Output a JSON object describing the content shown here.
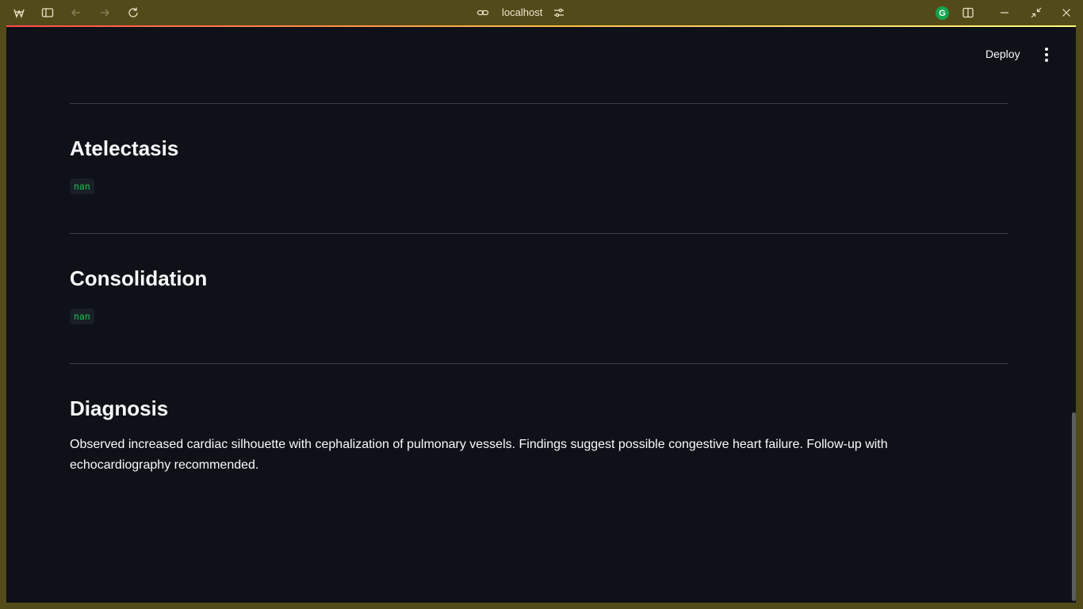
{
  "browser": {
    "url": "localhost",
    "icons": [
      "app-logo-icon",
      "sidebar-toggle-icon",
      "back-icon",
      "forward-icon",
      "reload-icon",
      "link-icon",
      "site-settings-icon",
      "grammarly-icon",
      "split-view-icon",
      "minimize-icon",
      "restore-icon",
      "close-icon"
    ],
    "grammarly_letter": "G"
  },
  "header": {
    "deploy_label": "Deploy"
  },
  "sections": [
    {
      "title": "Atelectasis",
      "value": "nan"
    },
    {
      "title": "Consolidation",
      "value": "nan"
    },
    {
      "title": "Diagnosis",
      "text": "Observed increased cardiac silhouette with cephalization of pulmonary vessels. Findings suggest possible congestive heart failure. Follow-up with echocardiography recommended."
    }
  ],
  "colors": {
    "background": "#0e1118",
    "window_frame": "#534a1a",
    "code_text": "#21c354",
    "text": "#fafafa"
  }
}
